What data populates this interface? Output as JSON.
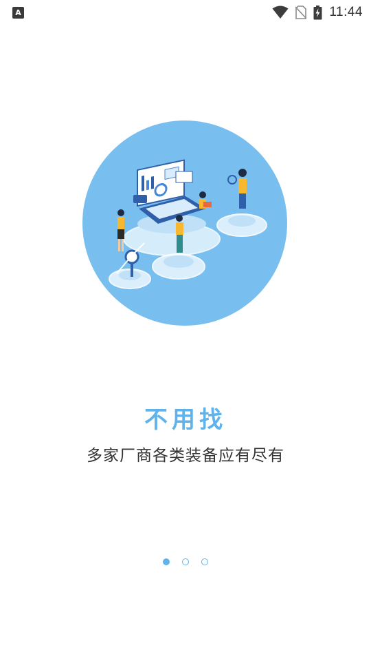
{
  "status_bar": {
    "left_icon": "A",
    "time": "11:44",
    "icons": [
      "wifi-icon",
      "no-sim-icon",
      "battery-charging-icon"
    ]
  },
  "onboarding": {
    "title": "不用找",
    "subtitle": "多家厂商各类装备应有尽有",
    "page_count": 3,
    "active_page": 0
  },
  "colors": {
    "accent": "#5fb3ea",
    "circle": "#78bff0"
  }
}
